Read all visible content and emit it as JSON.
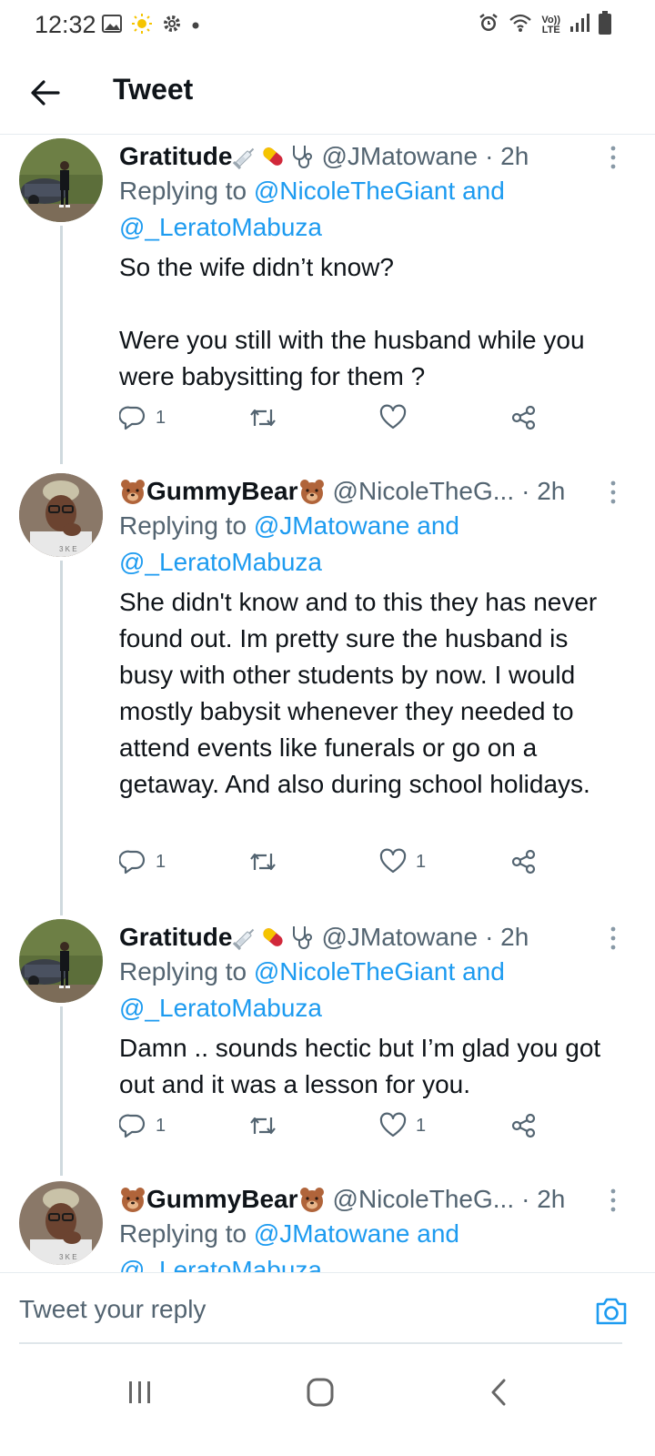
{
  "status_bar": {
    "time": "12:32",
    "left_icons": [
      "gallery-icon",
      "sun-icon",
      "gear-icon",
      "dot-icon"
    ],
    "right_icons": [
      "alarm-icon",
      "wifi-icon",
      "volte-icon",
      "signal-icon",
      "battery-icon"
    ],
    "lte_top": "Vo))",
    "lte_bottom": "LTE"
  },
  "header": {
    "title": "Tweet",
    "back_icon": "arrow-left-icon"
  },
  "tweets": [
    {
      "name": "Gratitude",
      "name_emojis": [
        "syringe-icon",
        "pill-icon",
        "stethoscope-icon"
      ],
      "handle": "@JMatowane",
      "time": "· 2h",
      "reply_prefix": "Replying to",
      "reply_user1": "@NicoleTheGiant",
      "reply_and": "and",
      "reply_user2": "@_LeratoMabuza",
      "text_lines": [
        "So the wife didn’t know?",
        "",
        "Were you still with the husband while you were babysitting for them ?"
      ],
      "replies": "1",
      "retweets": "",
      "likes": ""
    },
    {
      "name": "GummyBear",
      "name_emojis": [
        "bear-face-icon",
        "bear-face-icon"
      ],
      "handle": "@NicoleTheG...",
      "time": "· 2h",
      "reply_prefix": "Replying to",
      "reply_user1": "@JMatowane",
      "reply_and": "and",
      "reply_user2": "@_LeratoMabuza",
      "text_lines": [
        "She didn't know and to this they has never found out. Im pretty sure the husband is busy with other students by now. I would mostly babysit whenever they needed to attend events like funerals or go on a getaway. And also during school holidays."
      ],
      "replies": "1",
      "retweets": "",
      "likes": "1"
    },
    {
      "name": "Gratitude",
      "name_emojis": [
        "syringe-icon",
        "pill-icon",
        "stethoscope-icon"
      ],
      "handle": "@JMatowane",
      "time": "· 2h",
      "reply_prefix": "Replying to",
      "reply_user1": "@NicoleTheGiant",
      "reply_and": "and",
      "reply_user2": "@_LeratoMabuza",
      "text_lines": [
        "Damn .. sounds hectic but I’m glad you got out and it was a lesson for you."
      ],
      "replies": "1",
      "retweets": "",
      "likes": "1"
    },
    {
      "name": "GummyBear",
      "name_emojis": [
        "bear-face-icon",
        "bear-face-icon"
      ],
      "handle": "@NicoleTheG...",
      "time": "· 2h",
      "reply_prefix": "Replying to",
      "reply_user1": "@JMatowane",
      "reply_and": "and",
      "reply_user2": "@_LeratoMabuza"
    }
  ],
  "composer": {
    "placeholder": "Tweet your reply",
    "camera_icon": "camera-icon"
  },
  "nav": {
    "icons": [
      "recent-apps-icon",
      "home-icon",
      "back-icon"
    ]
  },
  "colors": {
    "link": "#1d9bf0",
    "text": "#0f1419",
    "muted": "#536471",
    "divider": "#e6ecf0"
  }
}
